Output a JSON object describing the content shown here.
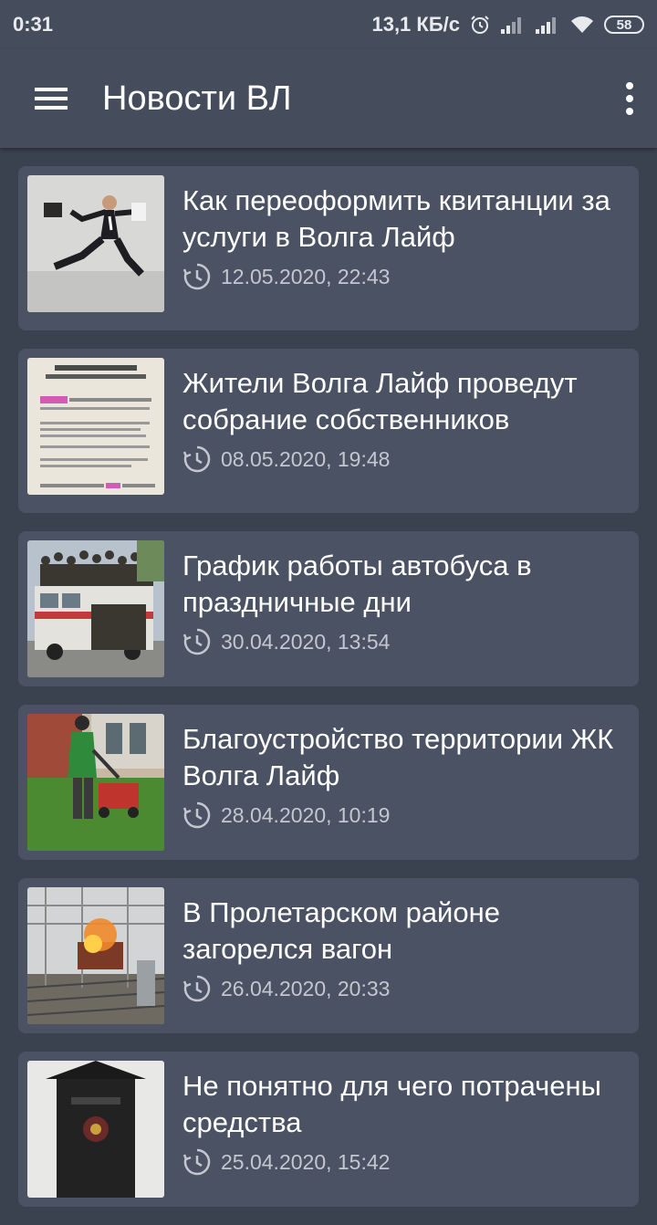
{
  "status_bar": {
    "time": "0:31",
    "net_speed": "13,1 КБ/с",
    "battery": "58",
    "icons": [
      "alarm-icon",
      "signal-icon",
      "signal-icon",
      "wifi-icon",
      "battery-icon"
    ]
  },
  "app_bar": {
    "title": "Новости ВЛ",
    "menu_icon": "hamburger-menu-icon",
    "overflow_icon": "more-vert-icon"
  },
  "articles": [
    {
      "title": "Как переоформить квитанции за услуги в Волга Лайф",
      "date": "12.05.2020, 22:43",
      "thumb": "businessman-jumping"
    },
    {
      "title": "Жители Волга Лайф проведут собрание собственников",
      "date": "08.05.2020, 19:48",
      "thumb": "notice-document"
    },
    {
      "title": "График работы автобуса в праздничные дни",
      "date": "30.04.2020, 13:54",
      "thumb": "crowded-bus"
    },
    {
      "title": "Благоустройство территории ЖК Волга Лайф",
      "date": "28.04.2020, 10:19",
      "thumb": "lawn-mowing"
    },
    {
      "title": "В Пролетарском районе загорелся вагон",
      "date": "26.04.2020, 20:33",
      "thumb": "burning-wagon"
    },
    {
      "title": "Не понятно для чего потрачены средства",
      "date": "25.04.2020, 15:42",
      "thumb": "mailbox"
    }
  ],
  "colors": {
    "background": "#3a4250",
    "app_bar": "#454d5c",
    "card": "#4a5263",
    "date_text": "#c2c7d0"
  }
}
